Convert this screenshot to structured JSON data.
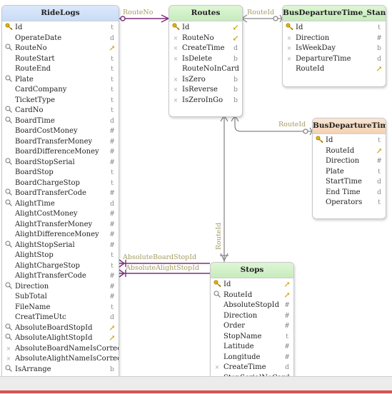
{
  "colors": {
    "link": "#7a2f7a",
    "link_gray": "#888888",
    "label": "#a59c62",
    "header_blue": "#c9dcf6",
    "header_green": "#c7ebbd",
    "header_orange": "#f2d2b4"
  },
  "tables": {
    "ridelogs": {
      "title": "RideLogs",
      "fields": [
        {
          "name": "Id",
          "icon": "key",
          "type": "t"
        },
        {
          "name": "OperateDate",
          "icon": "",
          "type": "d"
        },
        {
          "name": "RouteNo",
          "icon": "idx",
          "type": "fk"
        },
        {
          "name": "RouteStart",
          "icon": "",
          "type": "t"
        },
        {
          "name": "RouteEnd",
          "icon": "",
          "type": "t"
        },
        {
          "name": "Plate",
          "icon": "idx",
          "type": "t"
        },
        {
          "name": "CardCompany",
          "icon": "",
          "type": "t"
        },
        {
          "name": "TicketType",
          "icon": "",
          "type": "t"
        },
        {
          "name": "CardNo",
          "icon": "idx",
          "type": "t"
        },
        {
          "name": "BoardTime",
          "icon": "idx",
          "type": "d"
        },
        {
          "name": "BoardCostMoney",
          "icon": "",
          "type": "#"
        },
        {
          "name": "BoardTransferMoney",
          "icon": "",
          "type": "#"
        },
        {
          "name": "BoardDifferenceMoney",
          "icon": "",
          "type": "#"
        },
        {
          "name": "BoardStopSerial",
          "icon": "idx",
          "type": "#"
        },
        {
          "name": "BoardStop",
          "icon": "",
          "type": "t"
        },
        {
          "name": "BoardChargeStop",
          "icon": "",
          "type": "t"
        },
        {
          "name": "BoardTransferCode",
          "icon": "idx",
          "type": "#"
        },
        {
          "name": "AlightTime",
          "icon": "idx",
          "type": "d"
        },
        {
          "name": "AlightCostMoney",
          "icon": "",
          "type": "#"
        },
        {
          "name": "AlightTransferMoney",
          "icon": "",
          "type": "#"
        },
        {
          "name": "AlightDifferenceMoney",
          "icon": "",
          "type": "#"
        },
        {
          "name": "AlightStopSerial",
          "icon": "idx",
          "type": "#"
        },
        {
          "name": "AlightStop",
          "icon": "",
          "type": "t"
        },
        {
          "name": "AlightChargeStop",
          "icon": "",
          "type": "t"
        },
        {
          "name": "AlightTransferCode",
          "icon": "",
          "type": "#"
        },
        {
          "name": "Direction",
          "icon": "idx",
          "type": "#"
        },
        {
          "name": "SubTotal",
          "icon": "",
          "type": "#"
        },
        {
          "name": "FileName",
          "icon": "",
          "type": "t"
        },
        {
          "name": "CreatTimeUtc",
          "icon": "",
          "type": "d"
        },
        {
          "name": "AbsoluteBoardStopId",
          "icon": "idx",
          "type": "fk"
        },
        {
          "name": "AbsoluteAlightStopId",
          "icon": "idx",
          "type": "fk"
        },
        {
          "name": "AbsoluteBoardNameIsCorrect",
          "icon": "nn",
          "type": "b"
        },
        {
          "name": "AbsoluteAlightNameIsCorrect",
          "icon": "nn",
          "type": "b"
        },
        {
          "name": "IsArrange",
          "icon": "idx",
          "type": "b"
        }
      ]
    },
    "routes": {
      "title": "Routes",
      "fields": [
        {
          "name": "Id",
          "icon": "key",
          "type": "fk2"
        },
        {
          "name": "RouteNo",
          "icon": "nn",
          "type": "fk2"
        },
        {
          "name": "CreateTime",
          "icon": "nn",
          "type": "d"
        },
        {
          "name": "IsDelete",
          "icon": "nn",
          "type": "b"
        },
        {
          "name": "RouteNoInCard",
          "icon": "",
          "type": "t"
        },
        {
          "name": "IsZero",
          "icon": "nn",
          "type": "b"
        },
        {
          "name": "IsReverse",
          "icon": "nn",
          "type": "b"
        },
        {
          "name": "IsZeroInGo",
          "icon": "nn",
          "type": "b"
        }
      ]
    },
    "bdts": {
      "title": "BusDepartureTime_Standard",
      "fields": [
        {
          "name": "Id",
          "icon": "key",
          "type": "t"
        },
        {
          "name": "Direction",
          "icon": "nn",
          "type": "#"
        },
        {
          "name": "IsWeekDay",
          "icon": "nn",
          "type": "b"
        },
        {
          "name": "DepartureTime",
          "icon": "nn",
          "type": "d"
        },
        {
          "name": "RouteId",
          "icon": "",
          "type": "fk"
        }
      ]
    },
    "bdt": {
      "title": "BusDepartureTime",
      "fields": [
        {
          "name": "Id",
          "icon": "key",
          "type": "t"
        },
        {
          "name": "RouteId",
          "icon": "",
          "type": "fk"
        },
        {
          "name": "Direction",
          "icon": "",
          "type": "#"
        },
        {
          "name": "Plate",
          "icon": "",
          "type": "t"
        },
        {
          "name": "StartTime",
          "icon": "",
          "type": "d"
        },
        {
          "name": "End Time",
          "icon": "",
          "type": "d"
        },
        {
          "name": "Operators",
          "icon": "",
          "type": "t"
        }
      ]
    },
    "stops": {
      "title": "Stops",
      "fields": [
        {
          "name": "Id",
          "icon": "key",
          "type": "fk"
        },
        {
          "name": "RouteId",
          "icon": "idx",
          "type": "fk"
        },
        {
          "name": "AbsoluteStopId",
          "icon": "",
          "type": "#"
        },
        {
          "name": "Direction",
          "icon": "",
          "type": "#"
        },
        {
          "name": "Order",
          "icon": "",
          "type": "#"
        },
        {
          "name": "StopName",
          "icon": "",
          "type": "t"
        },
        {
          "name": "Latitude",
          "icon": "",
          "type": "#"
        },
        {
          "name": "Longitude",
          "icon": "",
          "type": "#"
        },
        {
          "name": "CreateTime",
          "icon": "nn",
          "type": "d"
        },
        {
          "name": "StopSerialNoCard",
          "icon": "",
          "type": ""
        }
      ]
    }
  },
  "relations": {
    "routeno": "RouteNo",
    "routeid_std": "RouteId",
    "routeid_bdt": "RouteId",
    "routeid_stops": "RouteId",
    "abs_board": "AbsoluteBoardStopId",
    "abs_alight": "AbsoluteAlightStopId"
  }
}
